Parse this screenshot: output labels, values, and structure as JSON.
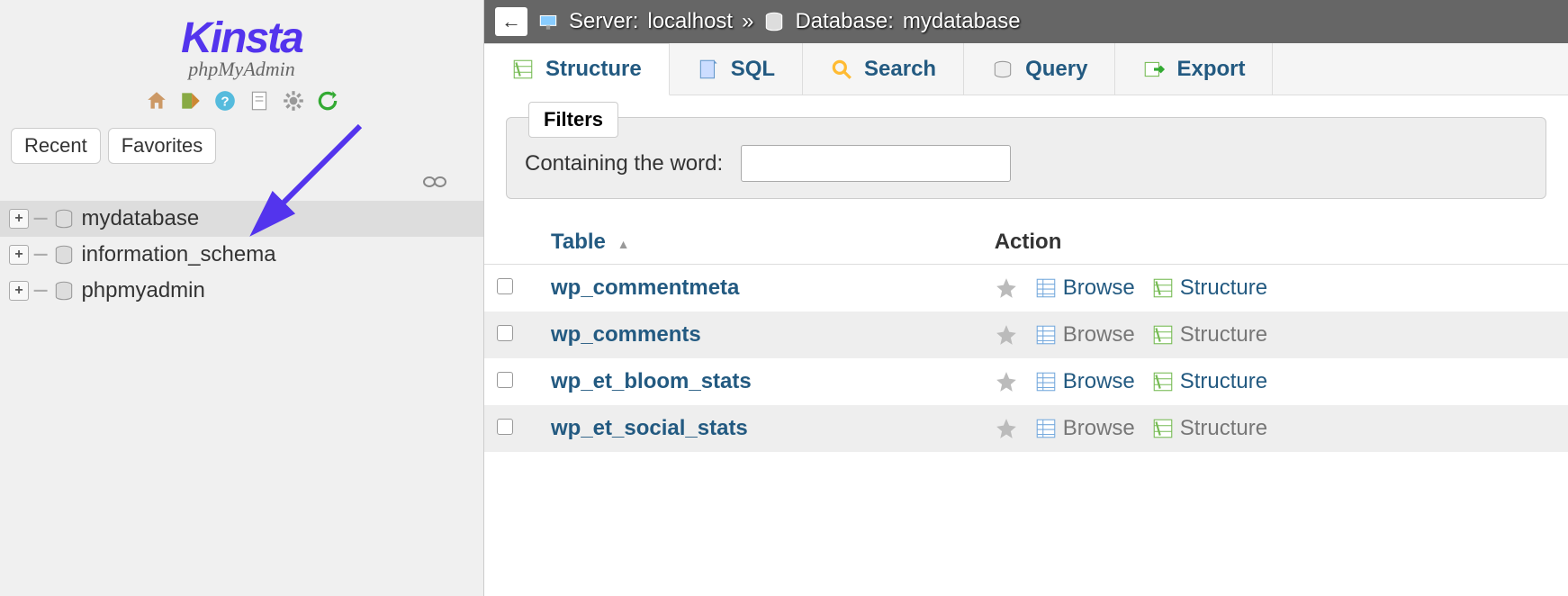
{
  "logo": {
    "brand": "Kinsta",
    "subtitle": "phpMyAdmin"
  },
  "sidebar": {
    "recent_label": "Recent",
    "favorites_label": "Favorites",
    "databases": [
      {
        "name": "mydatabase",
        "selected": true
      },
      {
        "name": "information_schema",
        "selected": false
      },
      {
        "name": "phpmyadmin",
        "selected": false
      }
    ]
  },
  "breadcrumb": {
    "server_label": "Server:",
    "server_value": "localhost",
    "separator": "»",
    "database_label": "Database:",
    "database_value": "mydatabase"
  },
  "tabs": [
    {
      "label": "Structure",
      "icon": "structure",
      "active": true
    },
    {
      "label": "SQL",
      "icon": "sql",
      "active": false
    },
    {
      "label": "Search",
      "icon": "search",
      "active": false
    },
    {
      "label": "Query",
      "icon": "query",
      "active": false
    },
    {
      "label": "Export",
      "icon": "export",
      "active": false
    }
  ],
  "filters": {
    "legend": "Filters",
    "containing_label": "Containing the word:",
    "value": ""
  },
  "table_header": {
    "table_col": "Table",
    "action_col": "Action"
  },
  "action_labels": {
    "browse": "Browse",
    "structure": "Structure"
  },
  "tables": [
    {
      "name": "wp_commentmeta"
    },
    {
      "name": "wp_comments"
    },
    {
      "name": "wp_et_bloom_stats"
    },
    {
      "name": "wp_et_social_stats"
    }
  ]
}
